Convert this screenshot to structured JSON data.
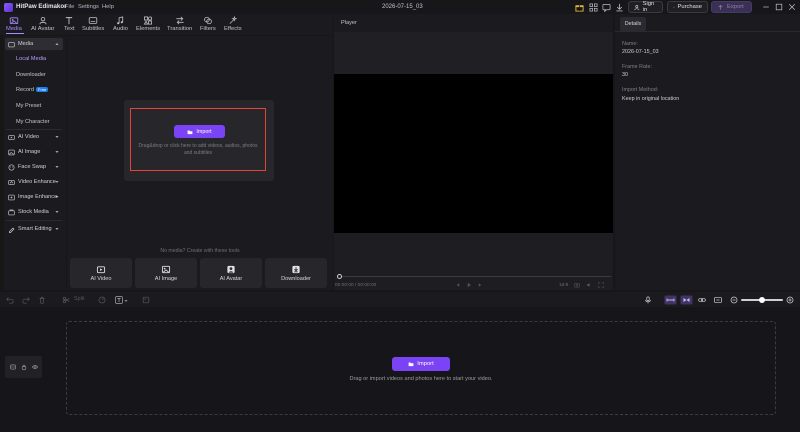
{
  "app": {
    "name": "HitPaw Edimakor",
    "menu": [
      "File",
      "Settings",
      "Help"
    ],
    "project_title": "2026-07-15_03",
    "sign_in": "Sign in",
    "purchase": "Purchase",
    "export": "Export"
  },
  "toolbar": {
    "tools": [
      {
        "label": "Media",
        "icon": "media-icon",
        "active": true
      },
      {
        "label": "AI Avatar",
        "icon": "ai-avatar-icon"
      },
      {
        "label": "Text",
        "icon": "text-icon"
      },
      {
        "label": "Subtitles",
        "icon": "subtitles-icon"
      },
      {
        "label": "Audio",
        "icon": "audio-icon"
      },
      {
        "label": "Elements",
        "icon": "elements-icon"
      },
      {
        "label": "Transition",
        "icon": "transition-icon"
      },
      {
        "label": "Filters",
        "icon": "filters-icon"
      },
      {
        "label": "Effects",
        "icon": "effects-icon"
      }
    ]
  },
  "sidebar": {
    "media": "Media",
    "sub_items": [
      "Local Media",
      "Downloader",
      "Record",
      "My Preset",
      "My Character"
    ],
    "free_badge": "Free",
    "groups": [
      "AI Video",
      "AI Image",
      "Face Swap",
      "Video Enhance",
      "Image Enhance",
      "Stock Media"
    ],
    "smart_editing": "Smart Editing"
  },
  "media_panel": {
    "import_label": "Import",
    "drop_hint": "Drag&drop or click here to add videos, audios, photos and subtitles",
    "no_media": "No media? Create with these tools",
    "tool_cards": [
      "AI Video",
      "AI Image",
      "AI Avatar",
      "Downloader"
    ]
  },
  "player": {
    "label": "Player",
    "time": "00:00:00 / 00:00:00",
    "zoom": "16:9"
  },
  "details": {
    "tab": "Details",
    "name_label": "Name:",
    "name_value": "2026-07-15_03",
    "frame_rate_label": "Frame Rate:",
    "frame_rate_value": "30",
    "import_method_label": "Import Method:",
    "import_method_value": "Keep in original location"
  },
  "timeline": {
    "split_label": "Split",
    "import_label": "Import",
    "hint": "Drag or import videos and photos here to start your video."
  },
  "colors": {
    "accent": "#7a43f5",
    "active_tab": "#a98bff",
    "highlight_border": "#e0453b"
  }
}
